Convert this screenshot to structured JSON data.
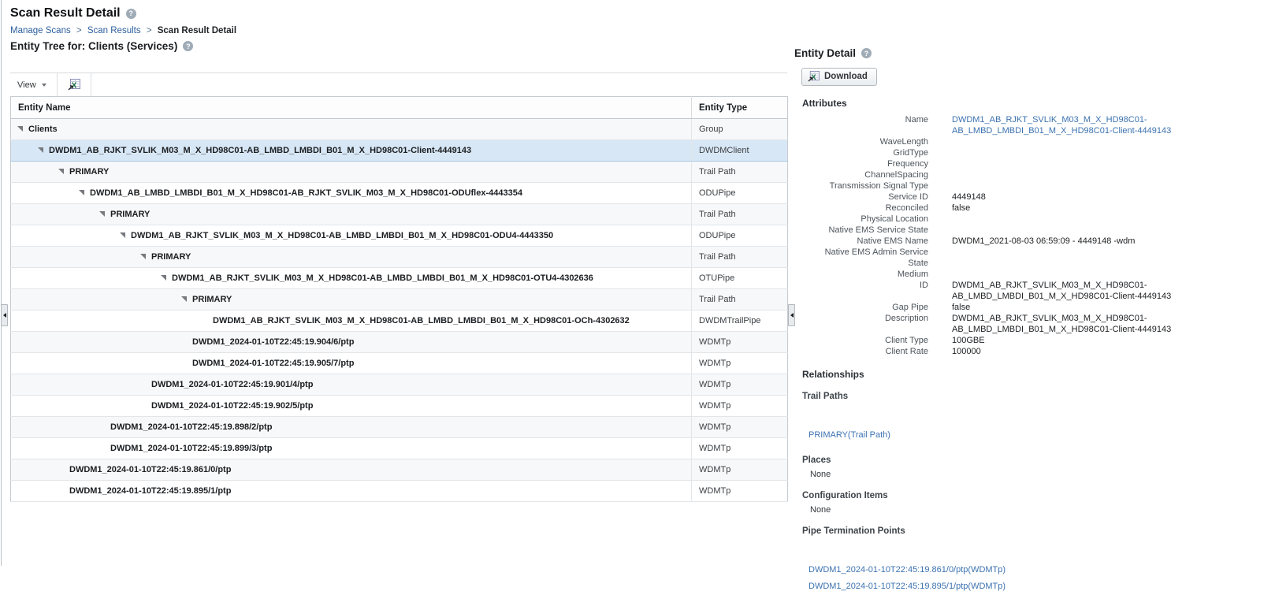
{
  "page": {
    "title": "Scan Result Detail",
    "subtitle": "Entity Tree for: Clients (Services)",
    "breadcrumb": {
      "items": [
        "Manage Scans",
        "Scan Results",
        "Scan Result Detail"
      ],
      "separator": ">"
    }
  },
  "toolbar": {
    "view_label": "View",
    "export_icon": "export-to-excel-icon"
  },
  "entity_tree": {
    "columns": [
      "Entity Name",
      "Entity Type"
    ],
    "rows": [
      {
        "name": "Clients",
        "type": "Group",
        "level": 0,
        "expandable": true,
        "selected": false
      },
      {
        "name": "DWDM1_AB_RJKT_SVLIK_M03_M_X_HD98C01-AB_LMBD_LMBDI_B01_M_X_HD98C01-Client-4449143",
        "type": "DWDMClient",
        "level": 1,
        "expandable": true,
        "selected": true
      },
      {
        "name": "PRIMARY",
        "type": "Trail Path",
        "level": 2,
        "expandable": true,
        "selected": false
      },
      {
        "name": "DWDM1_AB_LMBD_LMBDI_B01_M_X_HD98C01-AB_RJKT_SVLIK_M03_M_X_HD98C01-ODUflex-4443354",
        "type": "ODUPipe",
        "level": 3,
        "expandable": true,
        "selected": false
      },
      {
        "name": "PRIMARY",
        "type": "Trail Path",
        "level": 4,
        "expandable": true,
        "selected": false
      },
      {
        "name": "DWDM1_AB_RJKT_SVLIK_M03_M_X_HD98C01-AB_LMBD_LMBDI_B01_M_X_HD98C01-ODU4-4443350",
        "type": "ODUPipe",
        "level": 5,
        "expandable": true,
        "selected": false
      },
      {
        "name": "PRIMARY",
        "type": "Trail Path",
        "level": 6,
        "expandable": true,
        "selected": false
      },
      {
        "name": "DWDM1_AB_RJKT_SVLIK_M03_M_X_HD98C01-AB_LMBD_LMBDI_B01_M_X_HD98C01-OTU4-4302636",
        "type": "OTUPipe",
        "level": 7,
        "expandable": true,
        "selected": false
      },
      {
        "name": "PRIMARY",
        "type": "Trail Path",
        "level": 8,
        "expandable": true,
        "selected": false
      },
      {
        "name": "DWDM1_AB_RJKT_SVLIK_M03_M_X_HD98C01-AB_LMBD_LMBDI_B01_M_X_HD98C01-OCh-4302632",
        "type": "DWDMTrailPipe",
        "level": 9,
        "expandable": false,
        "selected": false
      },
      {
        "name": "DWDM1_2024-01-10T22:45:19.904/6/ptp",
        "type": "WDMTp",
        "level": 8,
        "expandable": false,
        "selected": false
      },
      {
        "name": "DWDM1_2024-01-10T22:45:19.905/7/ptp",
        "type": "WDMTp",
        "level": 8,
        "expandable": false,
        "selected": false
      },
      {
        "name": "DWDM1_2024-01-10T22:45:19.901/4/ptp",
        "type": "WDMTp",
        "level": 6,
        "expandable": false,
        "selected": false
      },
      {
        "name": "DWDM1_2024-01-10T22:45:19.902/5/ptp",
        "type": "WDMTp",
        "level": 6,
        "expandable": false,
        "selected": false
      },
      {
        "name": "DWDM1_2024-01-10T22:45:19.898/2/ptp",
        "type": "WDMTp",
        "level": 4,
        "expandable": false,
        "selected": false
      },
      {
        "name": "DWDM1_2024-01-10T22:45:19.899/3/ptp",
        "type": "WDMTp",
        "level": 4,
        "expandable": false,
        "selected": false
      },
      {
        "name": "DWDM1_2024-01-10T22:45:19.861/0/ptp",
        "type": "WDMTp",
        "level": 2,
        "expandable": false,
        "selected": false
      },
      {
        "name": "DWDM1_2024-01-10T22:45:19.895/1/ptp",
        "type": "WDMTp",
        "level": 2,
        "expandable": false,
        "selected": false
      }
    ]
  },
  "entity_detail": {
    "title": "Entity Detail",
    "download_label": "Download",
    "attributes_heading": "Attributes",
    "attributes": [
      {
        "label": "Name",
        "value": "DWDM1_AB_RJKT_SVLIK_M03_M_X_HD98C01-AB_LMBD_LMBDI_B01_M_X_HD98C01-Client-4449143",
        "link": true
      },
      {
        "label": "WaveLength",
        "value": ""
      },
      {
        "label": "GridType",
        "value": ""
      },
      {
        "label": "Frequency",
        "value": ""
      },
      {
        "label": "ChannelSpacing",
        "value": ""
      },
      {
        "label": "Transmission Signal Type",
        "value": ""
      },
      {
        "label": "Service ID",
        "value": "4449148"
      },
      {
        "label": "Reconciled",
        "value": "false"
      },
      {
        "label": "Physical Location",
        "value": ""
      },
      {
        "label": "Native EMS Service State",
        "value": ""
      },
      {
        "label": "Native EMS Name",
        "value": "DWDM1_2021-08-03 06:59:09 - 4449148 -wdm"
      },
      {
        "label": "Native EMS Admin Service State",
        "value": ""
      },
      {
        "label": "Medium",
        "value": ""
      },
      {
        "label": "ID",
        "value": "DWDM1_AB_RJKT_SVLIK_M03_M_X_HD98C01-AB_LMBD_LMBDI_B01_M_X_HD98C01-Client-4449143"
      },
      {
        "label": "Gap Pipe",
        "value": "false"
      },
      {
        "label": "Description",
        "value": "DWDM1_AB_RJKT_SVLIK_M03_M_X_HD98C01-AB_LMBD_LMBDI_B01_M_X_HD98C01-Client-4449143"
      },
      {
        "label": "Client Type",
        "value": "100GBE"
      },
      {
        "label": "Client Rate",
        "value": "100000"
      }
    ],
    "relationships": {
      "heading": "Relationships",
      "sections": [
        {
          "heading": "Trail Paths",
          "links": [
            "PRIMARY(Trail Path)"
          ]
        },
        {
          "heading": "Places",
          "empty": "None"
        },
        {
          "heading": "Configuration Items",
          "empty": "None"
        },
        {
          "heading": "Pipe Termination Points",
          "links": [
            "DWDM1_2024-01-10T22:45:19.861/0/ptp(WDMTp)",
            "DWDM1_2024-01-10T22:45:19.895/1/ptp(WDMTp)"
          ]
        }
      ]
    }
  },
  "colors": {
    "link_blue": "#3c72b0",
    "breadcrumb_link": "#2d5f9e",
    "selected_row_bg": "#d8e7f5",
    "alt_row_bg": "#f6f8fa",
    "excel_green": "#1e7145"
  }
}
